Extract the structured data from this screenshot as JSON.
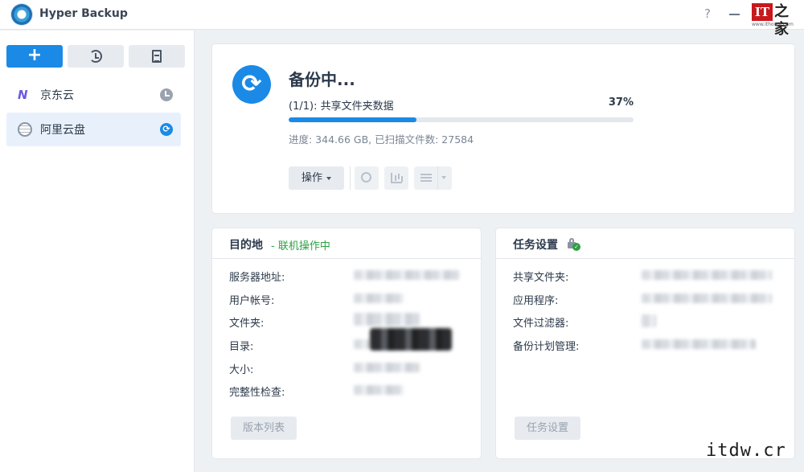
{
  "window": {
    "title": "Hyper Backup",
    "help_label": "?"
  },
  "watermark": {
    "it": "IT",
    "zh": "之家",
    "url": "www.ithome.com",
    "site": "itdw.cr"
  },
  "sidebar": {
    "add_label": "+",
    "tasks": [
      {
        "label": "京东云",
        "icon": "jdcloud-icon",
        "status": "clock-icon"
      },
      {
        "label": "阿里云盘",
        "icon": "globe-icon",
        "status": "sync-icon",
        "selected": true
      }
    ]
  },
  "status": {
    "title": "备份中...",
    "job": "(1/1): 共享文件夹数据",
    "percent_label": "37%",
    "progress_fraction": 0.37,
    "detail": "进度: 344.66 GB, 已扫描文件数: 27584",
    "ops_label": "操作"
  },
  "destination": {
    "title": "目的地",
    "online": "- 联机操作中",
    "rows": [
      "服务器地址:",
      "用户帐号:",
      "文件夹:",
      "目录:",
      "大小:",
      "完整性检查:"
    ],
    "button": "版本列表"
  },
  "settings": {
    "title": "任务设置",
    "rows": [
      "共享文件夹:",
      "应用程序:",
      "文件过滤器:",
      "备份计划管理:"
    ],
    "button": "任务设置"
  },
  "colors": {
    "accent": "#1a8ae6",
    "online": "#2ea043"
  }
}
